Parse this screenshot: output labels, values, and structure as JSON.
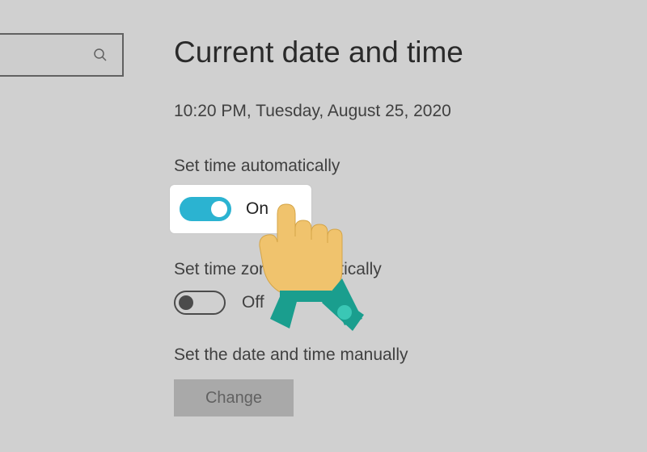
{
  "header": {
    "section_title": "Current date and time"
  },
  "datetime": {
    "display": "10:20 PM, Tuesday, August 25, 2020"
  },
  "settings": {
    "auto_time": {
      "label": "Set time automatically",
      "state_text": "On",
      "state": "on"
    },
    "auto_timezone": {
      "label": "Set time zone automatically",
      "state_text": "Off",
      "state": "off"
    },
    "manual": {
      "label": "Set the date and time manually",
      "button_text": "Change"
    }
  },
  "highlight": {
    "state_text": "On"
  },
  "colors": {
    "accent": "#0078d4",
    "highlight_toggle": "#2bb3d1",
    "hand_skin": "#f0c36d",
    "hand_cuff": "#1a9e8e",
    "hand_button": "#3ac7b5"
  }
}
